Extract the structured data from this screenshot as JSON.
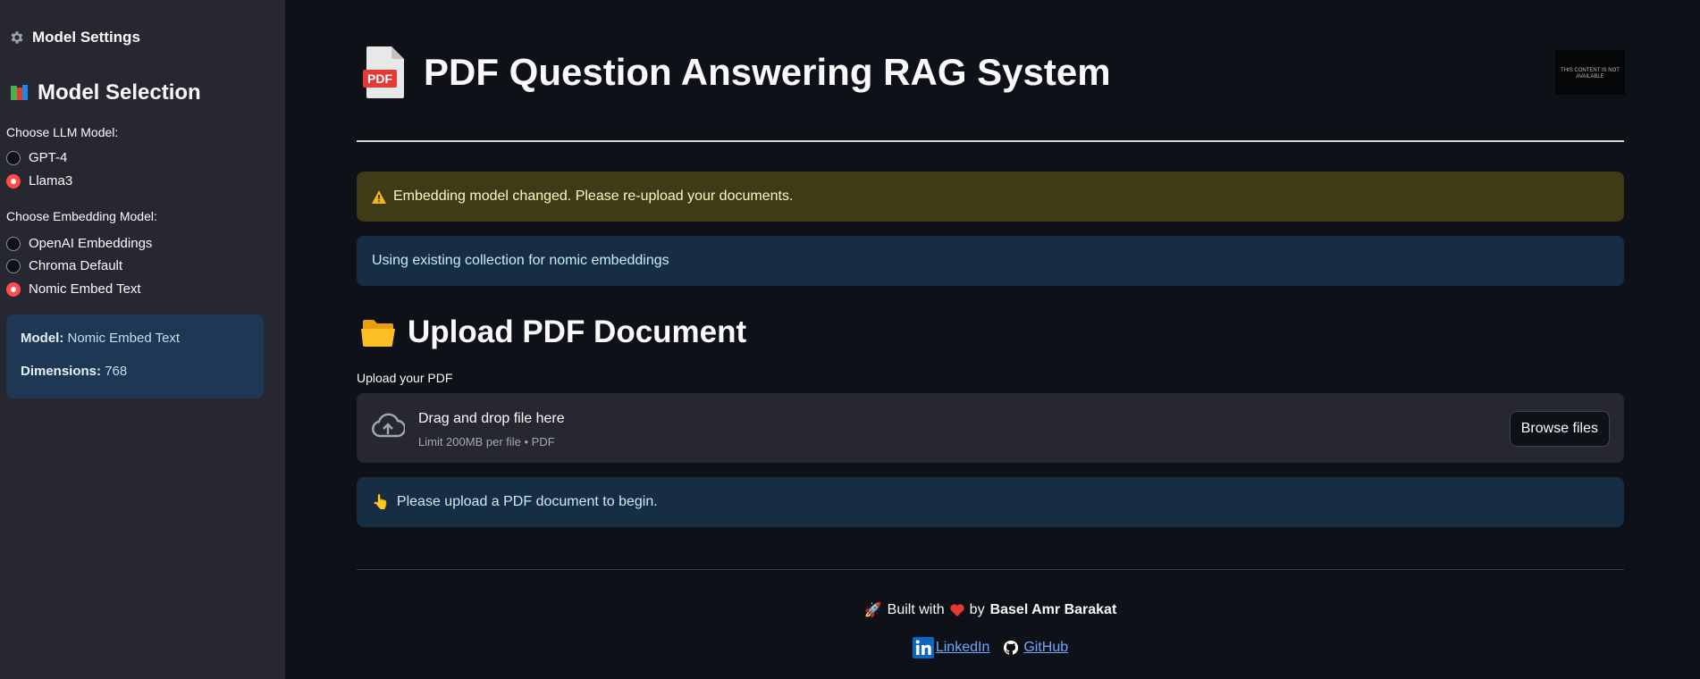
{
  "sidebar": {
    "settings_title": "Model Settings",
    "selection_heading": "Model Selection",
    "llm_label": "Choose LLM Model:",
    "llm_options": [
      "GPT-4",
      "Llama3"
    ],
    "llm_selected": "Llama3",
    "embedding_label": "Choose Embedding Model:",
    "embedding_options": [
      "OpenAI Embeddings",
      "Chroma Default",
      "Nomic Embed Text"
    ],
    "embedding_selected": "Nomic Embed Text",
    "info": {
      "model_key": "Model:",
      "model_value": "Nomic Embed Text",
      "dimensions_key": "Dimensions:",
      "dimensions_value": "768"
    }
  },
  "main": {
    "title": "PDF Question Answering RAG System",
    "pdf_icon_text": "PDF",
    "thumbnail_text": "THIS CONTENT IS NOT AVAILABLE",
    "warning": "Embedding model changed. Please re-upload your documents.",
    "info_collection": "Using existing collection for nomic embeddings",
    "upload_heading": "Upload PDF Document",
    "upload_label": "Upload your PDF",
    "dropzone_title": "Drag and drop file here",
    "dropzone_limit": "Limit 200MB per file • PDF",
    "browse_button": "Browse files",
    "upload_prompt": "Please upload a PDF document to begin."
  },
  "footer": {
    "built_with": "Built with",
    "by": "by",
    "author": "Basel Amr Barakat",
    "linkedin": "LinkedIn",
    "github": "GitHub"
  },
  "colors": {
    "background": "#0e1117",
    "sidebar": "#262730",
    "accent": "#ff4b4b",
    "warning_bg": "#3e3b16",
    "info_bg": "#172d43"
  }
}
